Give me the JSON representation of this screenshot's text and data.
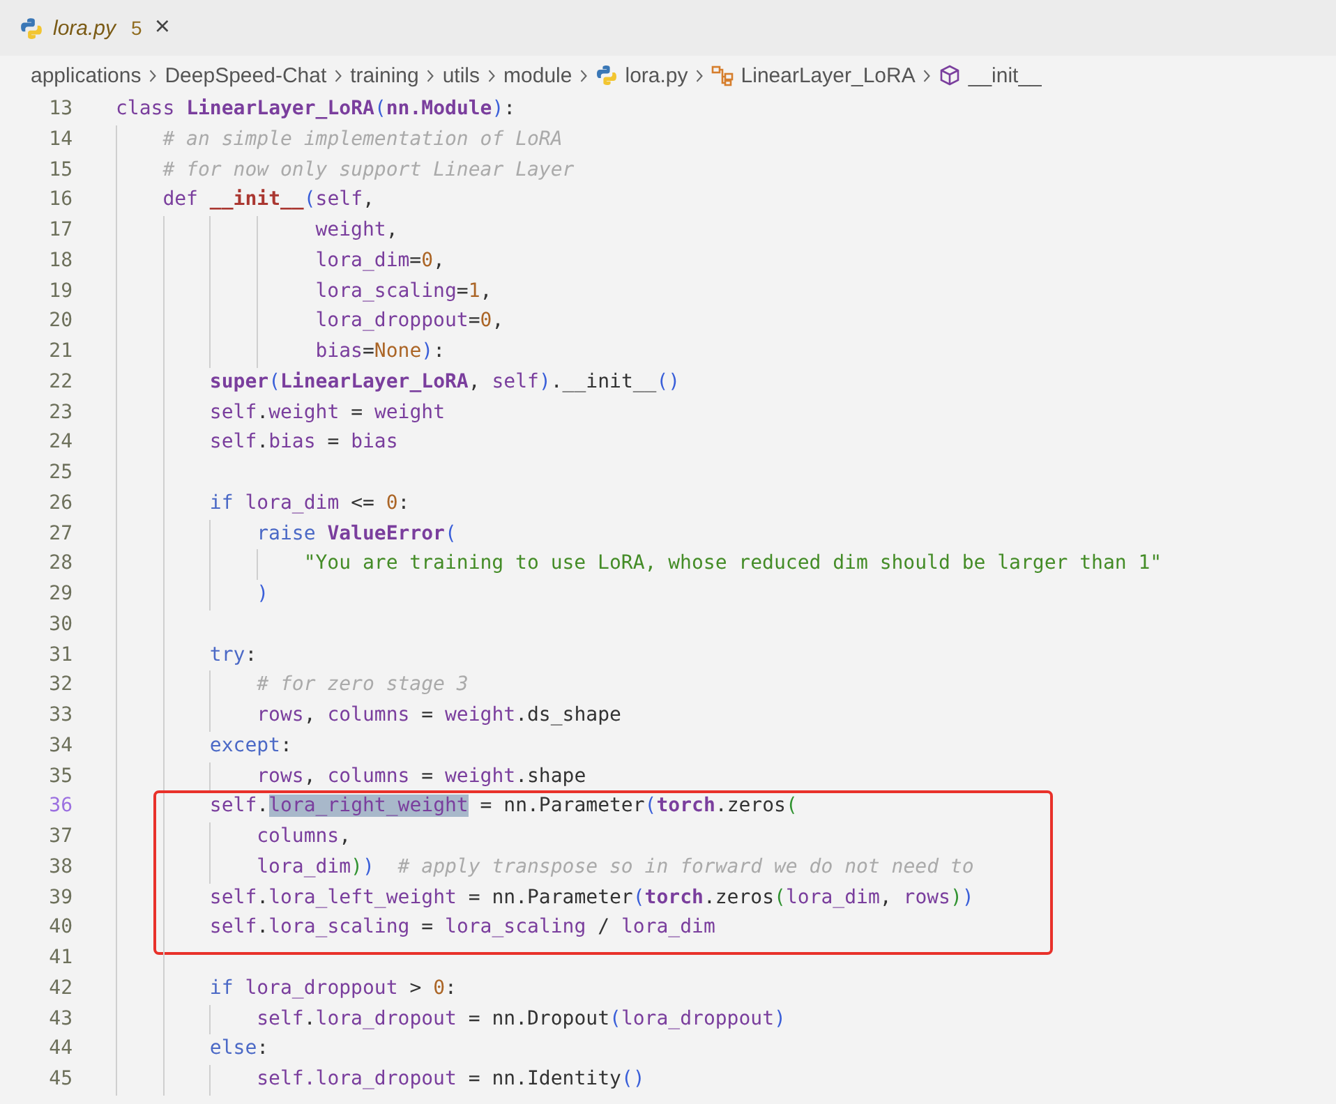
{
  "tabs": [
    {
      "label": "lora.py",
      "badge": "5",
      "close": "×",
      "preview": true
    }
  ],
  "breadcrumb": [
    {
      "label": "applications",
      "kind": "folder"
    },
    {
      "label": "DeepSpeed-Chat",
      "kind": "folder"
    },
    {
      "label": "training",
      "kind": "folder"
    },
    {
      "label": "utils",
      "kind": "folder"
    },
    {
      "label": "module",
      "kind": "folder"
    },
    {
      "label": "lora.py",
      "kind": "file"
    },
    {
      "label": "LinearLayer_LoRA",
      "kind": "class"
    },
    {
      "label": "__init__",
      "kind": "method"
    }
  ],
  "code": {
    "sections": [
      {
        "boxed": false,
        "lines": [
          {
            "number": "13",
            "active": false,
            "tokens": [
              {
                "text": "class ",
                "kind": "storage"
              },
              {
                "text": "LinearLayer_LoRA",
                "kind": "type"
              },
              {
                "text": "(",
                "kind": "paren"
              },
              {
                "text": "nn.Module",
                "kind": "type"
              },
              {
                "text": ")",
                "kind": "paren"
              },
              {
                "text": ":",
                "kind": "plain"
              }
            ]
          },
          {
            "number": "14",
            "active": false,
            "indent": [
              true
            ],
            "tokens": [
              {
                "text": "# an simple implementation of LoRA",
                "kind": "comment"
              }
            ]
          },
          {
            "number": "15",
            "active": false,
            "indent": [
              true
            ],
            "tokens": [
              {
                "text": "# for now only support Linear Layer",
                "kind": "comment"
              }
            ]
          },
          {
            "number": "16",
            "active": false,
            "indent": [
              true
            ],
            "tokens": [
              {
                "text": "def ",
                "kind": "storage"
              },
              {
                "text": "__init__",
                "kind": "function"
              },
              {
                "text": "(",
                "kind": "paren"
              },
              {
                "text": "self",
                "kind": "variable"
              },
              {
                "text": ",",
                "kind": "plain"
              }
            ]
          },
          {
            "number": "17",
            "active": false,
            "indent": [
              true,
              true,
              true,
              true
            ],
            "tokens": [
              {
                "text": " weight",
                "kind": "variable"
              },
              {
                "text": ",",
                "kind": "plain"
              }
            ]
          },
          {
            "number": "18",
            "active": false,
            "indent": [
              true,
              true,
              true,
              true
            ],
            "tokens": [
              {
                "text": " lora_dim",
                "kind": "variable"
              },
              {
                "text": "=",
                "kind": "plain"
              },
              {
                "text": "0",
                "kind": "number"
              },
              {
                "text": ",",
                "kind": "plain"
              }
            ]
          },
          {
            "number": "19",
            "active": false,
            "indent": [
              true,
              true,
              true,
              true
            ],
            "tokens": [
              {
                "text": " lora_scaling",
                "kind": "variable"
              },
              {
                "text": "=",
                "kind": "plain"
              },
              {
                "text": "1",
                "kind": "number"
              },
              {
                "text": ",",
                "kind": "plain"
              }
            ]
          },
          {
            "number": "20",
            "active": false,
            "indent": [
              true,
              true,
              true,
              true
            ],
            "tokens": [
              {
                "text": " lora_droppout",
                "kind": "variable"
              },
              {
                "text": "=",
                "kind": "plain"
              },
              {
                "text": "0",
                "kind": "number"
              },
              {
                "text": ",",
                "kind": "plain"
              }
            ]
          },
          {
            "number": "21",
            "active": false,
            "indent": [
              true,
              true,
              true,
              true
            ],
            "tokens": [
              {
                "text": " bias",
                "kind": "variable"
              },
              {
                "text": "=",
                "kind": "plain"
              },
              {
                "text": "None",
                "kind": "number"
              },
              {
                "text": ")",
                "kind": "paren"
              },
              {
                "text": ":",
                "kind": "plain"
              }
            ]
          },
          {
            "number": "22",
            "active": false,
            "indent": [
              true,
              true
            ],
            "tokens": [
              {
                "text": "super",
                "kind": "type"
              },
              {
                "text": "(",
                "kind": "paren"
              },
              {
                "text": "LinearLayer_LoRA",
                "kind": "type"
              },
              {
                "text": ", ",
                "kind": "plain"
              },
              {
                "text": "self",
                "kind": "variable"
              },
              {
                "text": ")",
                "kind": "paren"
              },
              {
                "text": ".__init__",
                "kind": "plain"
              },
              {
                "text": "()",
                "kind": "paren"
              }
            ]
          },
          {
            "number": "23",
            "active": false,
            "indent": [
              true,
              true
            ],
            "tokens": [
              {
                "text": "self",
                "kind": "variable"
              },
              {
                "text": ".",
                "kind": "plain"
              },
              {
                "text": "weight",
                "kind": "variable"
              },
              {
                "text": " = ",
                "kind": "plain"
              },
              {
                "text": "weight",
                "kind": "variable"
              }
            ]
          },
          {
            "number": "24",
            "active": false,
            "indent": [
              true,
              true
            ],
            "tokens": [
              {
                "text": "self",
                "kind": "variable"
              },
              {
                "text": ".",
                "kind": "plain"
              },
              {
                "text": "bias",
                "kind": "variable"
              },
              {
                "text": " = ",
                "kind": "plain"
              },
              {
                "text": "bias",
                "kind": "variable"
              }
            ]
          },
          {
            "number": "25",
            "active": false,
            "indent": [
              true,
              true
            ]
          },
          {
            "number": "26",
            "active": false,
            "indent": [
              true,
              true
            ],
            "tokens": [
              {
                "text": "if ",
                "kind": "keyword"
              },
              {
                "text": "lora_dim",
                "kind": "variable"
              },
              {
                "text": " <= ",
                "kind": "plain"
              },
              {
                "text": "0",
                "kind": "number"
              },
              {
                "text": ":",
                "kind": "plain"
              }
            ]
          },
          {
            "number": "27",
            "active": false,
            "indent": [
              true,
              true,
              true
            ],
            "tokens": [
              {
                "text": "raise ",
                "kind": "keyword"
              },
              {
                "text": "ValueError",
                "kind": "type"
              },
              {
                "text": "(",
                "kind": "paren"
              }
            ]
          },
          {
            "number": "28",
            "active": false,
            "indent": [
              true,
              true,
              true,
              true
            ],
            "tokens": [
              {
                "text": "\"You are training to use LoRA, whose reduced dim should be larger than 1\"",
                "kind": "string"
              }
            ]
          },
          {
            "number": "29",
            "active": false,
            "indent": [
              true,
              true,
              true
            ],
            "tokens": [
              {
                "text": ")",
                "kind": "paren"
              }
            ]
          },
          {
            "number": "30",
            "active": false,
            "indent": [
              true,
              true
            ]
          },
          {
            "number": "31",
            "active": false,
            "indent": [
              true,
              true
            ],
            "tokens": [
              {
                "text": "try",
                "kind": "keyword"
              },
              {
                "text": ":",
                "kind": "plain"
              }
            ]
          },
          {
            "number": "32",
            "active": false,
            "indent": [
              true,
              true,
              true
            ],
            "tokens": [
              {
                "text": "# for zero stage 3",
                "kind": "comment"
              }
            ]
          },
          {
            "number": "33",
            "active": false,
            "indent": [
              true,
              true,
              true
            ],
            "tokens": [
              {
                "text": "rows",
                "kind": "variable"
              },
              {
                "text": ", ",
                "kind": "plain"
              },
              {
                "text": "columns",
                "kind": "variable"
              },
              {
                "text": " = ",
                "kind": "plain"
              },
              {
                "text": "weight",
                "kind": "variable"
              },
              {
                "text": ".ds_shape",
                "kind": "plain"
              }
            ]
          },
          {
            "number": "34",
            "active": false,
            "indent": [
              true,
              true
            ],
            "tokens": [
              {
                "text": "except",
                "kind": "keyword"
              },
              {
                "text": ":",
                "kind": "plain"
              }
            ]
          },
          {
            "number": "35",
            "active": false,
            "indent": [
              true,
              true,
              true
            ],
            "tokens": [
              {
                "text": "rows",
                "kind": "variable"
              },
              {
                "text": ", ",
                "kind": "plain"
              },
              {
                "text": "columns",
                "kind": "variable"
              },
              {
                "text": " = ",
                "kind": "plain"
              },
              {
                "text": "weight",
                "kind": "variable"
              },
              {
                "text": ".shape",
                "kind": "plain"
              }
            ]
          }
        ]
      },
      {
        "boxed": true,
        "lines": [
          {
            "number": "36",
            "active": true,
            "indent": [
              true,
              true
            ],
            "tokens": [
              {
                "text": "self",
                "kind": "variable"
              },
              {
                "text": ".",
                "kind": "plain"
              },
              {
                "text": "lora_right_weight",
                "kind": "selection"
              },
              {
                "text": " = nn.Parameter",
                "kind": "plain"
              },
              {
                "text": "(",
                "kind": "paren"
              },
              {
                "text": "torch",
                "kind": "type"
              },
              {
                "text": ".zeros",
                "kind": "plain"
              },
              {
                "text": "(",
                "kind": "paren2"
              }
            ]
          },
          {
            "number": "37",
            "active": false,
            "indent": [
              true,
              true,
              true
            ],
            "tokens": [
              {
                "text": "columns",
                "kind": "variable"
              },
              {
                "text": ",",
                "kind": "plain"
              }
            ]
          },
          {
            "number": "38",
            "active": false,
            "indent": [
              true,
              true,
              true
            ],
            "tokens": [
              {
                "text": "lora_dim",
                "kind": "variable"
              },
              {
                "text": ")",
                "kind": "paren2"
              },
              {
                "text": ")",
                "kind": "paren"
              },
              {
                "text": "  # apply transpose so in forward we do not need to",
                "kind": "comment"
              }
            ]
          },
          {
            "number": "39",
            "active": false,
            "indent": [
              true,
              true
            ],
            "tokens": [
              {
                "text": "self",
                "kind": "variable"
              },
              {
                "text": ".",
                "kind": "plain"
              },
              {
                "text": "lora_left_weight",
                "kind": "variable"
              },
              {
                "text": " = nn.Parameter",
                "kind": "plain"
              },
              {
                "text": "(",
                "kind": "paren"
              },
              {
                "text": "torch",
                "kind": "type"
              },
              {
                "text": ".zeros",
                "kind": "plain"
              },
              {
                "text": "(",
                "kind": "paren2"
              },
              {
                "text": "lora_dim",
                "kind": "variable"
              },
              {
                "text": ", ",
                "kind": "plain"
              },
              {
                "text": "rows",
                "kind": "variable"
              },
              {
                "text": ")",
                "kind": "paren2"
              },
              {
                "text": ")",
                "kind": "paren"
              }
            ]
          },
          {
            "number": "40",
            "active": false,
            "indent": [
              true,
              true
            ],
            "tokens": [
              {
                "text": "self",
                "kind": "variable"
              },
              {
                "text": ".",
                "kind": "plain"
              },
              {
                "text": "lora_scaling",
                "kind": "variable"
              },
              {
                "text": " = ",
                "kind": "plain"
              },
              {
                "text": "lora_scaling",
                "kind": "variable"
              },
              {
                "text": " / ",
                "kind": "plain"
              },
              {
                "text": "lora_dim",
                "kind": "variable"
              }
            ]
          }
        ]
      },
      {
        "boxed": false,
        "lines": [
          {
            "number": "41",
            "active": false,
            "indent": [
              true,
              true
            ]
          },
          {
            "number": "42",
            "active": false,
            "indent": [
              true,
              true
            ],
            "tokens": [
              {
                "text": "if ",
                "kind": "keyword"
              },
              {
                "text": "lora_droppout",
                "kind": "variable"
              },
              {
                "text": " > ",
                "kind": "plain"
              },
              {
                "text": "0",
                "kind": "number"
              },
              {
                "text": ":",
                "kind": "plain"
              }
            ]
          },
          {
            "number": "43",
            "active": false,
            "indent": [
              true,
              true,
              true
            ],
            "tokens": [
              {
                "text": "self",
                "kind": "variable"
              },
              {
                "text": ".",
                "kind": "plain"
              },
              {
                "text": "lora_dropout",
                "kind": "variable"
              },
              {
                "text": " = nn.Dropout",
                "kind": "plain"
              },
              {
                "text": "(",
                "kind": "paren"
              },
              {
                "text": "lora_droppout",
                "kind": "variable"
              },
              {
                "text": ")",
                "kind": "paren"
              }
            ]
          },
          {
            "number": "44",
            "active": false,
            "indent": [
              true,
              true
            ],
            "tokens": [
              {
                "text": "else",
                "kind": "keyword"
              },
              {
                "text": ":",
                "kind": "plain"
              }
            ]
          },
          {
            "number": "45",
            "active": false,
            "indent": [
              true,
              true,
              true
            ],
            "tokens": [
              {
                "text": "self.",
                "kind": "variable"
              },
              {
                "text": "lora_dropout",
                "kind": "variable"
              },
              {
                "text": " = nn.Identity",
                "kind": "plain"
              },
              {
                "text": "()",
                "kind": "paren"
              }
            ]
          }
        ]
      }
    ]
  }
}
